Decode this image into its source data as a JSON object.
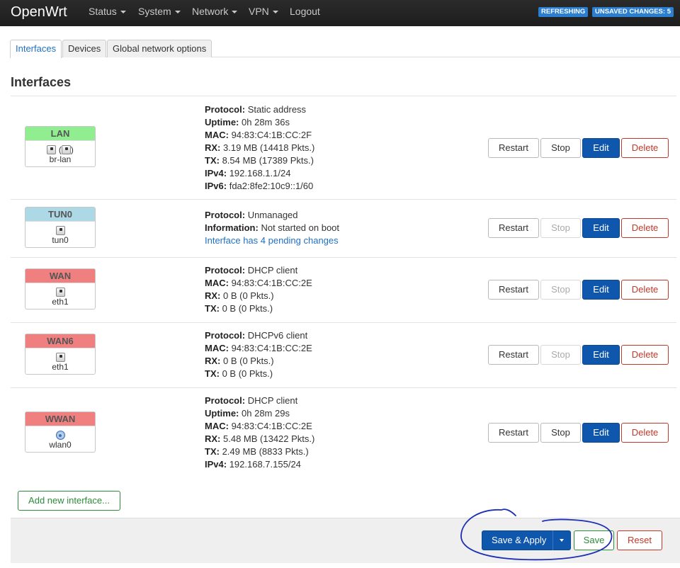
{
  "app": {
    "brand": "OpenWrt",
    "nav": [
      "Status",
      "System",
      "Network",
      "VPN",
      "Logout"
    ],
    "badges": {
      "refreshing": "REFRESHING",
      "unsaved": "UNSAVED CHANGES: 5"
    }
  },
  "tabs": [
    "Interfaces",
    "Devices",
    "Global network options"
  ],
  "section_title": "Interfaces",
  "buttons": {
    "restart": "Restart",
    "stop": "Stop",
    "edit": "Edit",
    "delete": "Delete"
  },
  "interfaces": [
    {
      "name": "LAN",
      "color": "#90ee90",
      "device": "br-lan",
      "stop_enabled": true,
      "info": [
        {
          "k": "Protocol:",
          "v": "Static address"
        },
        {
          "k": "Uptime:",
          "v": "0h 28m 36s"
        },
        {
          "k": "MAC:",
          "v": "94:83:C4:1B:CC:2F"
        },
        {
          "k": "RX:",
          "v": "3.19 MB (14418 Pkts.)"
        },
        {
          "k": "TX:",
          "v": "8.54 MB (17389 Pkts.)"
        },
        {
          "k": "IPv4:",
          "v": "192.168.1.1/24"
        },
        {
          "k": "IPv6:",
          "v": "fda2:8fe2:10c9::1/60"
        }
      ]
    },
    {
      "name": "TUN0",
      "color": "#add8e6",
      "device": "tun0",
      "stop_enabled": false,
      "info": [
        {
          "k": "Protocol:",
          "v": "Unmanaged"
        },
        {
          "k": "Information:",
          "v": "Not started on boot"
        }
      ],
      "pending": "Interface has 4 pending changes"
    },
    {
      "name": "WAN",
      "color": "#f08080",
      "device": "eth1",
      "stop_enabled": false,
      "info": [
        {
          "k": "Protocol:",
          "v": "DHCP client"
        },
        {
          "k": "MAC:",
          "v": "94:83:C4:1B:CC:2E"
        },
        {
          "k": "RX:",
          "v": "0 B (0 Pkts.)"
        },
        {
          "k": "TX:",
          "v": "0 B (0 Pkts.)"
        }
      ]
    },
    {
      "name": "WAN6",
      "color": "#f08080",
      "device": "eth1",
      "stop_enabled": false,
      "info": [
        {
          "k": "Protocol:",
          "v": "DHCPv6 client"
        },
        {
          "k": "MAC:",
          "v": "94:83:C4:1B:CC:2E"
        },
        {
          "k": "RX:",
          "v": "0 B (0 Pkts.)"
        },
        {
          "k": "TX:",
          "v": "0 B (0 Pkts.)"
        }
      ]
    },
    {
      "name": "WWAN",
      "color": "#f08080",
      "device": "wlan0",
      "stop_enabled": true,
      "info": [
        {
          "k": "Protocol:",
          "v": "DHCP client"
        },
        {
          "k": "Uptime:",
          "v": "0h 28m 29s"
        },
        {
          "k": "MAC:",
          "v": "94:83:C4:1B:CC:2E"
        },
        {
          "k": "RX:",
          "v": "5.48 MB (13422 Pkts.)"
        },
        {
          "k": "TX:",
          "v": "2.49 MB (8833 Pkts.)"
        },
        {
          "k": "IPv4:",
          "v": "192.168.7.155/24"
        }
      ]
    }
  ],
  "add_interface": "Add new interface...",
  "footer": {
    "save_apply": "Save & Apply",
    "save": "Save",
    "reset": "Reset"
  }
}
